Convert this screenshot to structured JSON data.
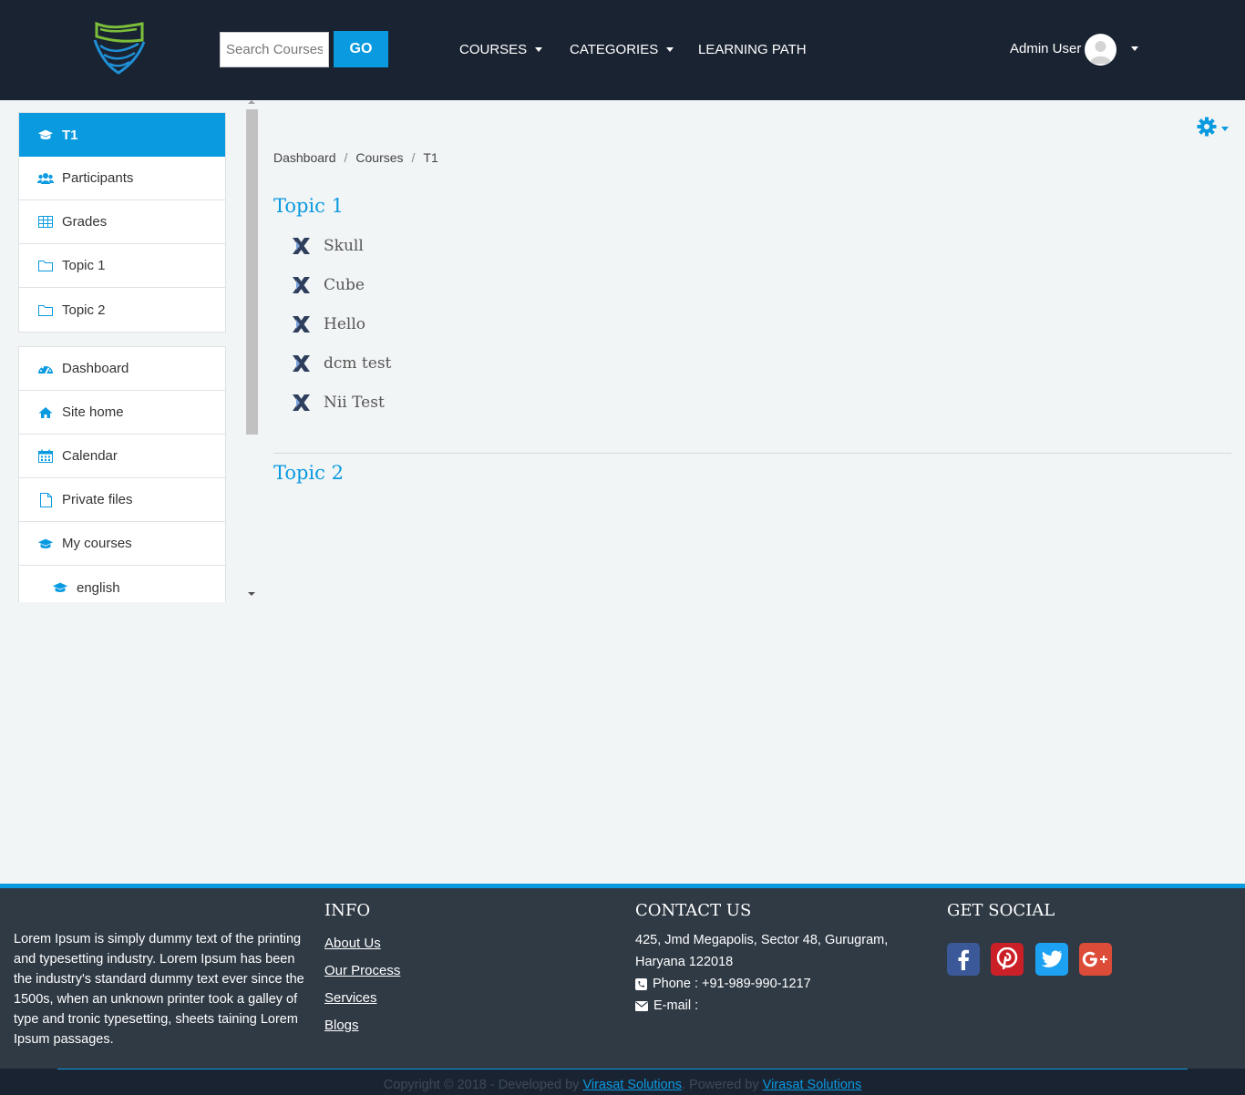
{
  "header": {
    "search_placeholder": "Search Courses",
    "go_label": "GO",
    "nav": [
      {
        "label": "COURSES",
        "has_caret": true
      },
      {
        "label": "CATEGORIES",
        "has_caret": true
      },
      {
        "label": "LEARNING PATH",
        "has_caret": false
      }
    ],
    "user_name": "Admin User"
  },
  "sidebar": {
    "course_nav": [
      {
        "label": "T1",
        "icon": "graduation-cap-icon",
        "active": true
      },
      {
        "label": "Participants",
        "icon": "users-icon"
      },
      {
        "label": "Grades",
        "icon": "table-icon"
      },
      {
        "label": "Topic 1",
        "icon": "folder-icon"
      },
      {
        "label": "Topic 2",
        "icon": "folder-icon"
      }
    ],
    "site_nav": [
      {
        "label": "Dashboard",
        "icon": "dashboard-icon"
      },
      {
        "label": "Site home",
        "icon": "home-icon"
      },
      {
        "label": "Calendar",
        "icon": "calendar-icon"
      },
      {
        "label": "Private files",
        "icon": "file-icon"
      },
      {
        "label": "My courses",
        "icon": "graduation-cap-icon"
      },
      {
        "label": "english",
        "icon": "graduation-cap-icon"
      }
    ]
  },
  "breadcrumb": [
    "Dashboard",
    "Courses",
    "T1"
  ],
  "topics": [
    {
      "title": "Topic 1",
      "activities": [
        "Skull",
        "Cube",
        "Hello",
        "dcm test",
        "Nii Test"
      ]
    },
    {
      "title": "Topic 2",
      "activities": []
    }
  ],
  "footer": {
    "about": "Lorem Ipsum is simply dummy text of the printing and typesetting industry. Lorem Ipsum has been the industry's standard dummy text ever since the 1500s, when an unknown printer took a galley of type and tronic typesetting, sheets taining Lorem Ipsum passages.",
    "info_heading": "INFO",
    "info_links": [
      "About Us",
      "Our Process",
      "Services",
      "Blogs"
    ],
    "contact_heading": "CONTACT US",
    "address_line1": "425, Jmd Megapolis, Sector 48, Gurugram,",
    "address_line2": "Haryana 122018",
    "phone": "Phone : +91-989-990-1217",
    "email": "E-mail :",
    "social_heading": "GET SOCIAL",
    "social": [
      {
        "name": "facebook",
        "color": "#3b5998"
      },
      {
        "name": "pinterest",
        "color": "#cb2027"
      },
      {
        "name": "twitter",
        "color": "#1da1f2"
      },
      {
        "name": "google-plus",
        "color": "#dd4b39"
      }
    ],
    "copyright_prefix": "Copyright © 2018 - Developed by",
    "developer": "Virasat Solutions",
    "powered_prefix": ". Powered by",
    "powered": "Virasat Solutions"
  },
  "colors": {
    "accent": "#0a9ae0",
    "header_bg": "#1a2332",
    "footer_bg": "#2f3a45"
  }
}
